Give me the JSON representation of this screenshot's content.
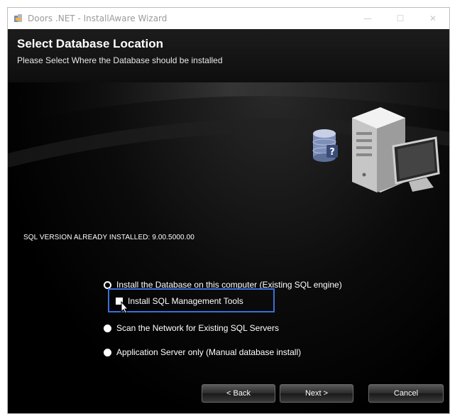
{
  "window": {
    "title": "Doors .NET - InstallAware Wizard",
    "controls": {
      "minimize": "—",
      "maximize": "☐",
      "close": "✕"
    }
  },
  "header": {
    "title": "Select Database Location",
    "subtitle": "Please Select Where the Database should be installed"
  },
  "sql_version": "SQL VERSION ALREADY INSTALLED: 9.00.5000.00",
  "options": {
    "install_local": {
      "label": "Install the Database on this computer (Existing SQL engine)",
      "selected": true
    },
    "install_tools": {
      "label": "Install SQL Management Tools",
      "checked": false
    },
    "scan_network": {
      "label": "Scan the Network for Existing SQL Servers",
      "selected": false
    },
    "app_server": {
      "label": "Application Server only (Manual database install)",
      "selected": false
    }
  },
  "buttons": {
    "back": "< Back",
    "next": "Next >",
    "cancel": "Cancel"
  },
  "icons": [
    "installaware-icon",
    "database-question-icon",
    "server-tower-icon",
    "monitor-icon",
    "mouse-cursor-icon"
  ]
}
